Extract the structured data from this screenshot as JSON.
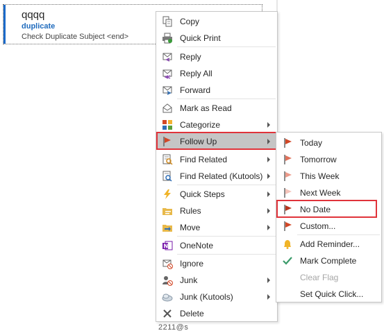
{
  "mail": {
    "sender": "qqqq",
    "category": "duplicate",
    "subject": "Check Duplicate Subject <end>"
  },
  "background_fragment": "2211@s",
  "context_menu": {
    "items": [
      {
        "id": "copy",
        "label": "Copy",
        "icon": "copy-icon",
        "submenu": false
      },
      {
        "id": "quick-print",
        "label": "Quick Print",
        "icon": "printer-icon",
        "submenu": false
      },
      {
        "id": "reply",
        "label": "Reply",
        "icon": "reply-icon",
        "submenu": false
      },
      {
        "id": "reply-all",
        "label": "Reply All",
        "icon": "reply-all-icon",
        "submenu": false
      },
      {
        "id": "forward",
        "label": "Forward",
        "icon": "forward-icon",
        "submenu": false
      },
      {
        "id": "mark-as-read",
        "label": "Mark as Read",
        "icon": "envelope-open-icon",
        "submenu": false
      },
      {
        "id": "categorize",
        "label": "Categorize",
        "icon": "categorize-grid-icon",
        "submenu": true
      },
      {
        "id": "follow-up",
        "label": "Follow Up",
        "icon": "flag-icon",
        "submenu": true,
        "highlighted": true
      },
      {
        "id": "find-related",
        "label": "Find Related",
        "icon": "find-related-icon",
        "submenu": true
      },
      {
        "id": "find-related-kutools",
        "label": "Find Related (Kutools)",
        "icon": "find-related-kutools-icon",
        "submenu": true
      },
      {
        "id": "quick-steps",
        "label": "Quick Steps",
        "icon": "lightning-icon",
        "submenu": true
      },
      {
        "id": "rules",
        "label": "Rules",
        "icon": "rules-folder-icon",
        "submenu": true
      },
      {
        "id": "move",
        "label": "Move",
        "icon": "move-folder-icon",
        "submenu": true
      },
      {
        "id": "onenote",
        "label": "OneNote",
        "icon": "onenote-icon",
        "submenu": false
      },
      {
        "id": "ignore",
        "label": "Ignore",
        "icon": "ignore-icon",
        "submenu": false
      },
      {
        "id": "junk",
        "label": "Junk",
        "icon": "junk-icon",
        "submenu": true
      },
      {
        "id": "junk-kutools",
        "label": "Junk (Kutools)",
        "icon": "junk-kutools-icon",
        "submenu": true
      },
      {
        "id": "delete",
        "label": "Delete",
        "icon": "delete-x-icon",
        "submenu": false
      }
    ]
  },
  "follow_up_submenu": {
    "items": [
      {
        "id": "today",
        "label": "Today",
        "icon": "flag-today-icon"
      },
      {
        "id": "tomorrow",
        "label": "Tomorrow",
        "icon": "flag-tomorrow-icon"
      },
      {
        "id": "this-week",
        "label": "This Week",
        "icon": "flag-this-week-icon"
      },
      {
        "id": "next-week",
        "label": "Next Week",
        "icon": "flag-next-week-icon"
      },
      {
        "id": "no-date",
        "label": "No Date",
        "icon": "flag-no-date-icon",
        "highlighted_box": true
      },
      {
        "id": "custom",
        "label": "Custom...",
        "icon": "flag-custom-icon"
      },
      {
        "id": "add-reminder",
        "label": "Add Reminder...",
        "icon": "bell-icon"
      },
      {
        "id": "mark-complete",
        "label": "Mark Complete",
        "icon": "checkmark-icon"
      },
      {
        "id": "clear-flag",
        "label": "Clear Flag",
        "icon": "",
        "disabled": true
      },
      {
        "id": "set-quick-click",
        "label": "Set Quick Click...",
        "icon": ""
      }
    ]
  },
  "colors": {
    "highlight": "#c5c5c5",
    "annotation_red": "#e0333a",
    "flag_red": "#d24726",
    "accent_blue": "#1f6bbd"
  }
}
